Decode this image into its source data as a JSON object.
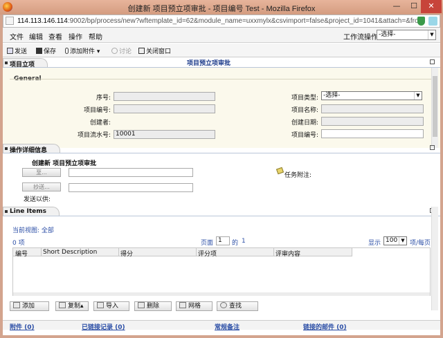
{
  "window": {
    "title": "创建新 项目预立项审批 - 项目编号 Test - Mozilla Firefox",
    "min_glyph": "—",
    "max_glyph": "☐",
    "close_glyph": "✕"
  },
  "address": {
    "host": "114.113.146.114",
    "rest": ":9002/bp/process/new?wftemplate_id=62&module_name=uxxmylx&csvimport=false&project_id=1041&attach=&fromDn"
  },
  "menu": {
    "items": [
      "文件",
      "编辑",
      "查看",
      "操作",
      "帮助"
    ],
    "workflow_label": "工作流操作",
    "workflow_value": "-选择-"
  },
  "toolbar": {
    "send": "发送",
    "save": "保存",
    "attach": "添加附件",
    "discuss": "讨论",
    "close": "关闭窗口"
  },
  "project": {
    "tab": "项目立项",
    "center_title": "项目预立项审批",
    "general_legend": "General",
    "fields": {
      "seq_label": "序号:",
      "code_label": "项目编号:",
      "creator_label": "创建者:",
      "serial_label": "项目流水号:",
      "serial_value": "10001",
      "type_label": "项目类型:",
      "type_value": "-选择-",
      "name_label": "项目名称:",
      "date_label": "创建日期:",
      "code2_label": "项目编号:"
    }
  },
  "detail": {
    "tab": "操作详细信息",
    "title": "创建新 项目预立项审批",
    "to_button": "至...",
    "cc_button": "抄送...",
    "task_note_label": "任务附注:",
    "send_for_label": "发送以供:"
  },
  "line_items": {
    "tab": "Line Items",
    "current_view_label": "当前视图:",
    "current_view_value": "全部",
    "count_text": "0 项",
    "page_label": "页面",
    "page_value": "1",
    "of_label": "的",
    "total_pages": "1",
    "show_label": "显示",
    "page_size": "100",
    "per_page_label": "项/每页",
    "columns": [
      "编号",
      "Short Description",
      "得分",
      "评分项",
      "评审内容"
    ]
  },
  "actions": {
    "add": "添加",
    "copy": "复制",
    "import": "导入",
    "delete": "删除",
    "grid": "网格",
    "find": "查找"
  },
  "footer": {
    "attachments": "附件 (0)",
    "linked_records": "已链接记录 (0)",
    "notes": "常规备注",
    "linked_mail": "链接的邮件 (0)"
  },
  "colors": {
    "titlebar": "#d49c80",
    "close": "#c7443a",
    "link": "#2b4ea6",
    "cream": "#fbf9ec"
  }
}
